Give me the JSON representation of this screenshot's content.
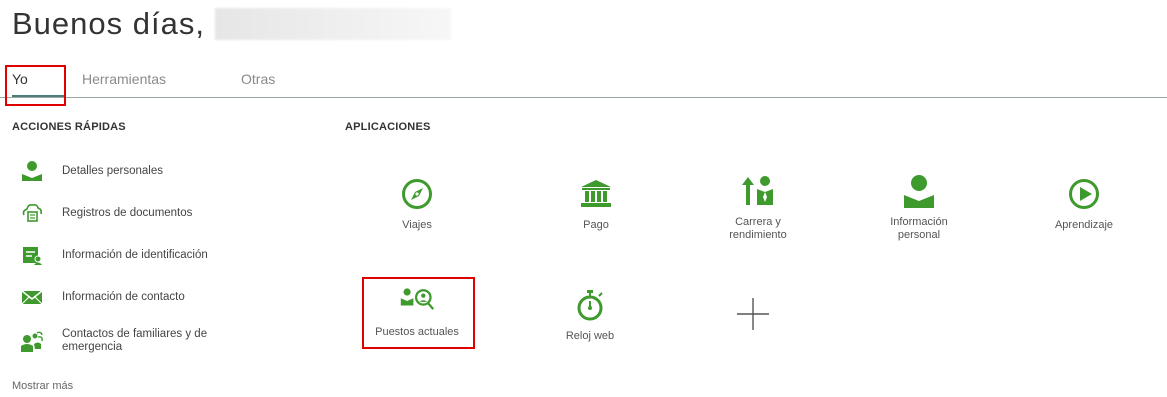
{
  "header": {
    "greeting": "Buenos días,"
  },
  "tabs": [
    {
      "label": "Yo",
      "active": true
    },
    {
      "label": "Herramientas",
      "active": false
    },
    {
      "label": "Otras",
      "active": false
    }
  ],
  "quick_actions": {
    "title": "ACCIONES RÁPIDAS",
    "items": [
      {
        "label": "Detalles personales",
        "icon": "person-icon"
      },
      {
        "label": "Registros de documentos",
        "icon": "document-records-icon"
      },
      {
        "label": "Información de identificación",
        "icon": "id-card-icon"
      },
      {
        "label": "Información de contacto",
        "icon": "envelope-icon"
      },
      {
        "label": "Contactos de familiares y de emergencia",
        "icon": "family-contacts-icon"
      }
    ],
    "show_more": "Mostrar más"
  },
  "apps": {
    "title": "APLICACIONES",
    "items": [
      {
        "label": "Viajes",
        "icon": "compass-icon"
      },
      {
        "label": "Pago",
        "icon": "bank-icon"
      },
      {
        "label": "Carrera y rendimiento",
        "icon": "career-icon"
      },
      {
        "label": "Información personal",
        "icon": "person-icon"
      },
      {
        "label": "Aprendizaje",
        "icon": "play-icon"
      },
      {
        "label": "Puestos actuales",
        "icon": "search-people-icon"
      },
      {
        "label": "Reloj web",
        "icon": "stopwatch-icon"
      },
      {
        "label": "",
        "icon": "plus-icon"
      }
    ]
  },
  "colors": {
    "icon_green": "#3e9a2d",
    "highlight_red": "#e00000",
    "tab_underline": "#4d7d76"
  }
}
